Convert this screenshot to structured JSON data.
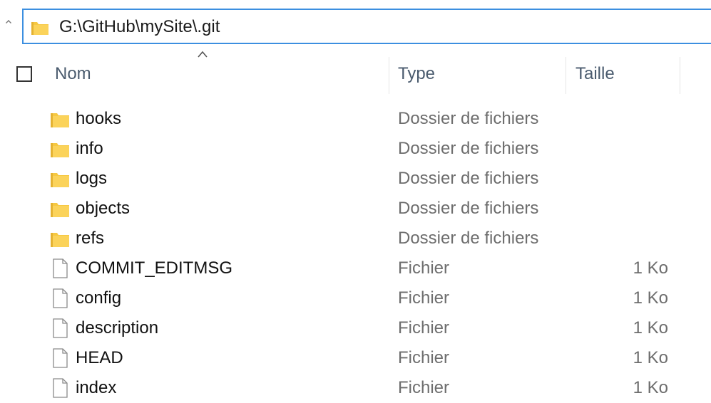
{
  "address": {
    "path": "G:\\GitHub\\mySite\\.git",
    "icon": "folder-icon"
  },
  "columns": {
    "name": "Nom",
    "type": "Type",
    "size": "Taille",
    "sorted_by": "name",
    "sort_direction": "ascending"
  },
  "colors": {
    "address_border": "#3c8fe0",
    "folder": "#f6c842",
    "header_text": "#4a5b6e",
    "secondary_text": "#6d6d6d"
  },
  "files": [
    {
      "name": "hooks",
      "type": "Dossier de fichiers",
      "size": "",
      "icon": "folder-icon"
    },
    {
      "name": "info",
      "type": "Dossier de fichiers",
      "size": "",
      "icon": "folder-icon"
    },
    {
      "name": "logs",
      "type": "Dossier de fichiers",
      "size": "",
      "icon": "folder-icon"
    },
    {
      "name": "objects",
      "type": "Dossier de fichiers",
      "size": "",
      "icon": "folder-icon"
    },
    {
      "name": "refs",
      "type": "Dossier de fichiers",
      "size": "",
      "icon": "folder-icon"
    },
    {
      "name": "COMMIT_EDITMSG",
      "type": "Fichier",
      "size": "1 Ko",
      "icon": "file-icon"
    },
    {
      "name": "config",
      "type": "Fichier",
      "size": "1 Ko",
      "icon": "file-icon"
    },
    {
      "name": "description",
      "type": "Fichier",
      "size": "1 Ko",
      "icon": "file-icon"
    },
    {
      "name": "HEAD",
      "type": "Fichier",
      "size": "1 Ko",
      "icon": "file-icon"
    },
    {
      "name": "index",
      "type": "Fichier",
      "size": "1 Ko",
      "icon": "file-icon"
    }
  ]
}
